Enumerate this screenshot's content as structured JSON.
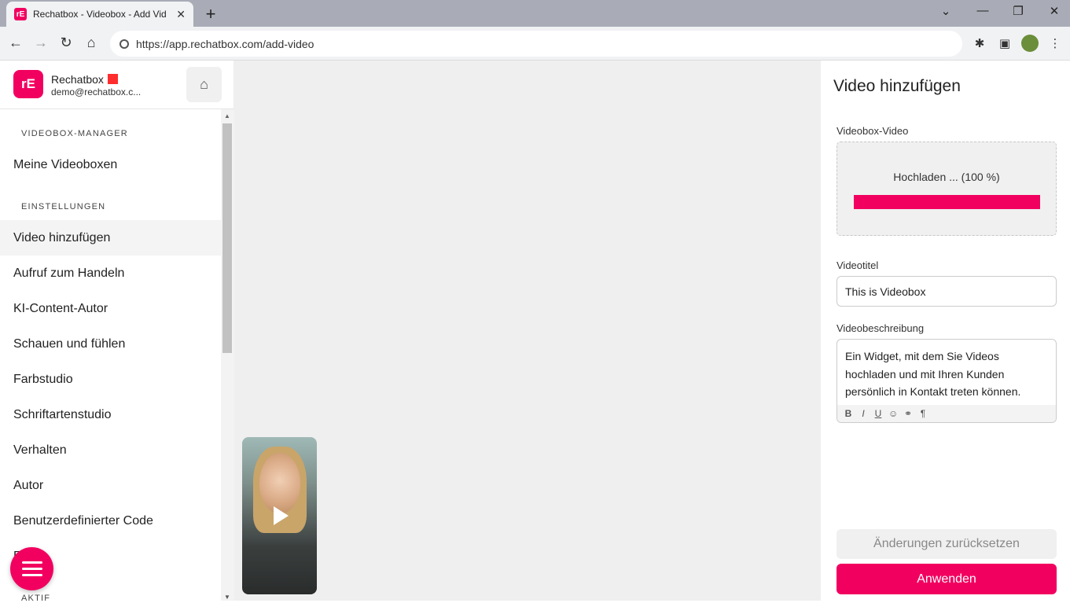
{
  "browser": {
    "tab_title": "Rechatbox - Videobox - Add Vid",
    "tab_close": "✕",
    "new_tab": "+",
    "url": "https://app.rechatbox.com/add-video",
    "window_controls": [
      "⌄",
      "—",
      "❐",
      "✕"
    ]
  },
  "brand": {
    "logo_text": "rE",
    "name": "Rechatbox",
    "email": "demo@rechatbox.c..."
  },
  "sidebar": {
    "sections": [
      {
        "label": "VIDEOBOX-MANAGER"
      },
      {
        "label": "EINSTELLUNGEN"
      },
      {
        "label": "AKTIF"
      }
    ],
    "items": [
      {
        "label": "Meine Videoboxen"
      },
      {
        "label": "Video hinzufügen"
      },
      {
        "label": "Aufruf zum Handeln"
      },
      {
        "label": "KI-Content-Autor"
      },
      {
        "label": "Schauen und fühlen"
      },
      {
        "label": "Farbstudio"
      },
      {
        "label": "Schriftartenstudio"
      },
      {
        "label": "Verhalten"
      },
      {
        "label": "Autor"
      },
      {
        "label": "Benutzerdefinierter Code"
      },
      {
        "label": "Regle"
      }
    ],
    "active_item": "Video hinzufügen"
  },
  "panel": {
    "title": "Video hinzufügen",
    "video_label": "Videobox-Video",
    "upload_status": "Hochladen ... (100 %)",
    "upload_progress": 1.0,
    "title_label": "Videotitel",
    "title_value": "This is Videobox",
    "description_label": "Videobeschreibung",
    "description_lines": [
      "Ein Widget, mit dem Sie Videos",
      "hochladen und mit Ihren Kunden",
      "persönlich in Kontakt treten können."
    ],
    "editor_tools": [
      "B",
      "I",
      "U",
      "☺",
      "⚭",
      "¶"
    ],
    "reset_label": "Änderungen zurücksetzen",
    "apply_label": "Anwenden"
  },
  "colors": {
    "accent": "#f20060",
    "flag": "#ff2d2d"
  }
}
